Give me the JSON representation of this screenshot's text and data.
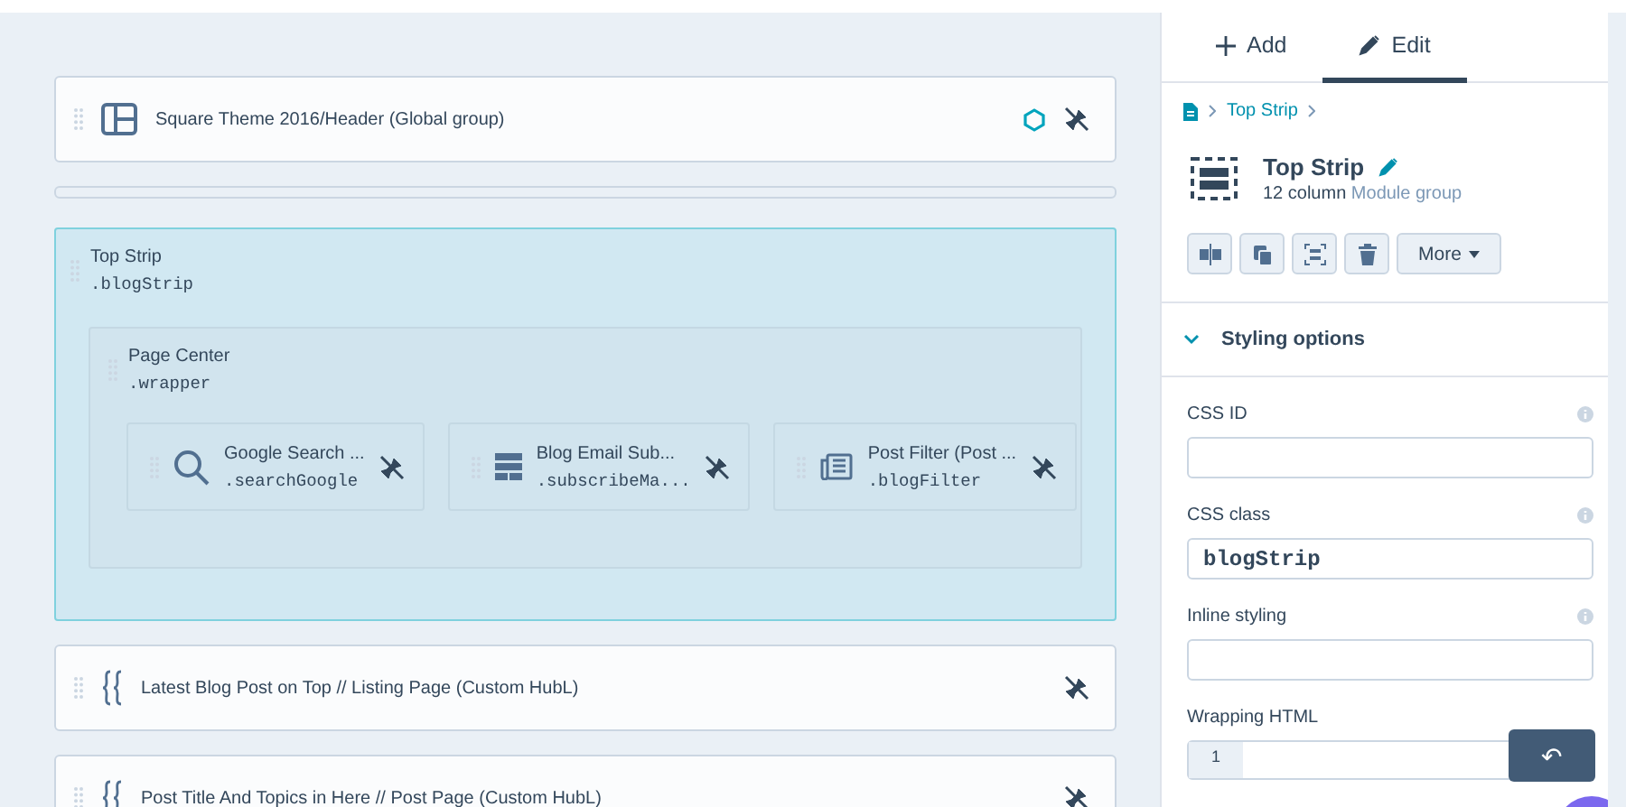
{
  "canvas": {
    "rows": [
      {
        "kind": "module",
        "title": "Square Theme 2016/Header (Global group)",
        "global": true
      },
      {
        "kind": "spacer"
      },
      {
        "kind": "group",
        "title": "Top Strip",
        "class_name": ".blogStrip",
        "selected": true,
        "groups": [
          {
            "title": "Page Center",
            "class_name": ".wrapper",
            "modules": [
              {
                "title": "Google Search ...",
                "class_name": ".searchGoogle"
              },
              {
                "title": "Blog Email Sub...",
                "class_name": ".subscribeMa..."
              },
              {
                "title": "Post Filter (Post ...",
                "class_name": ".blogFilter"
              }
            ]
          }
        ]
      },
      {
        "kind": "module",
        "title": "Latest Blog Post on Top // Listing Page (Custom HubL)",
        "global": false
      },
      {
        "kind": "module",
        "title": "Post Title And Topics in Here // Post Page (Custom HubL)",
        "global": false
      }
    ]
  },
  "panel": {
    "tabs": [
      {
        "label": "Add",
        "selected": false
      },
      {
        "label": "Edit",
        "selected": true
      }
    ],
    "breadcrumb": [
      "Top Strip"
    ],
    "title": "Top Strip",
    "subtitle": "12 column",
    "subtitle_link": "Module group",
    "more_button": "More",
    "section": {
      "title": "Styling options",
      "expanded": true
    },
    "fields": [
      {
        "kind": "input",
        "label": "CSS ID"
      },
      {
        "kind": "input",
        "label": "CSS class",
        "value": "blogStrip"
      },
      {
        "kind": "input",
        "label": "Inline styling"
      },
      {
        "kind": "code",
        "label": "Wrapping HTML",
        "line_number": "1"
      }
    ],
    "undo_button": "↶"
  }
}
